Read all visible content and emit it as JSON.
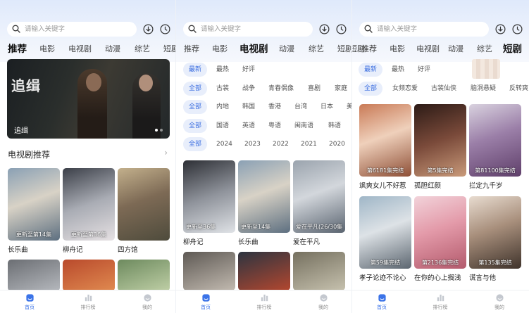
{
  "search": {
    "placeholder": "请输入关键字"
  },
  "colors": {
    "accent": "#3b73e8",
    "chip_selected_bg": "#e8eefb",
    "chip_selected_text": "#3b6ee0"
  },
  "icons": {
    "search": "search-icon",
    "download": "download-icon",
    "history": "history-icon",
    "home": "home-icon",
    "ranking": "ranking-icon",
    "profile": "profile-icon"
  },
  "screen1": {
    "tabs": [
      "推荐",
      "电影",
      "电视剧",
      "动漫",
      "综艺",
      "短剧"
    ],
    "active_tab": "推荐",
    "banner": {
      "logo_text": "追缉",
      "caption": "追缉"
    },
    "section_title": "电视剧推荐",
    "section_more": "›",
    "posters": [
      {
        "title": "长乐曲",
        "badge": "更新至第14集"
      },
      {
        "title": "柳舟记",
        "badge": "更新至第36集"
      },
      {
        "title": "四方馆",
        "badge": ""
      }
    ]
  },
  "screen2": {
    "tabs": [
      "推荐",
      "电影",
      "电视剧",
      "动漫",
      "综艺",
      "短剧"
    ],
    "active_tab": "电视剧",
    "filters": {
      "sort": [
        "最新",
        "最热",
        "好评"
      ],
      "genre": [
        "全部",
        "古装",
        "战争",
        "青春偶像",
        "喜剧",
        "家庭"
      ],
      "region": [
        "全部",
        "内地",
        "韩国",
        "香港",
        "台湾",
        "日本",
        "美"
      ],
      "language": [
        "全部",
        "国语",
        "英语",
        "粤语",
        "闽南语",
        "韩语"
      ],
      "year": [
        "全部",
        "2024",
        "2023",
        "2022",
        "2021",
        "2020"
      ]
    },
    "posters": [
      {
        "title": "柳舟记",
        "badge": "更新至36集"
      },
      {
        "title": "长乐曲",
        "badge": "更新至14集"
      },
      {
        "title": "爱在平凡",
        "badge": "爱在平凡(26/30集"
      }
    ]
  },
  "screen3": {
    "tabs": [
      "短剧",
      "推荐",
      "电影",
      "电视剧",
      "动漫",
      "综艺",
      "短剧"
    ],
    "active_tab": "短剧",
    "filters": {
      "sort": [
        "最新",
        "最热",
        "好评"
      ],
      "genre": [
        "全部",
        "女频恋爱",
        "古装仙侠",
        "脑洞悬疑",
        "反转爽"
      ]
    },
    "posters": [
      {
        "title": "飒爽女儿不好惹",
        "badge": "第6181集完结"
      },
      {
        "title": "孤胆红颜",
        "badge": "第5集完结"
      },
      {
        "title": "拦定九千岁",
        "badge": "第81100集完结"
      },
      {
        "title": "孝子论迹不论心",
        "badge": "第59集完结"
      },
      {
        "title": "在你的心上搁浅",
        "badge": "第2136集完结"
      },
      {
        "title": "谎言与他",
        "badge": "第135集完结"
      }
    ]
  },
  "nav": {
    "home": "首页",
    "ranking": "排行榜",
    "profile": "我的"
  }
}
